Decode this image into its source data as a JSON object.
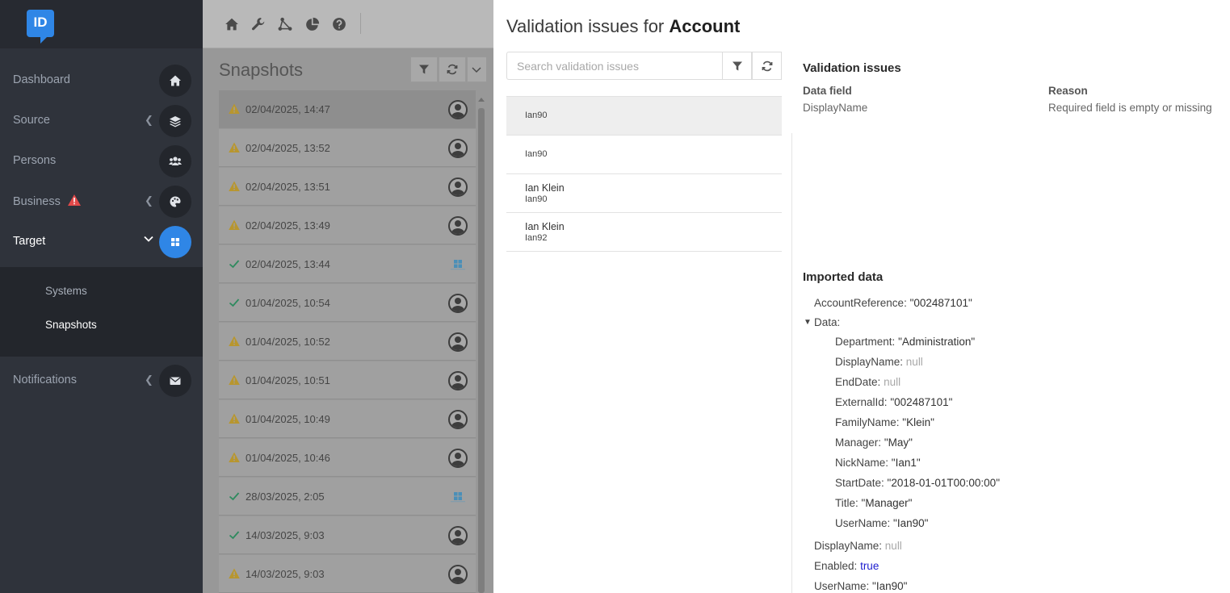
{
  "app": {
    "logo_text": "ID"
  },
  "sidebar": {
    "items": [
      {
        "label": "Dashboard",
        "icon": "home-icon"
      },
      {
        "label": "Source",
        "icon": "layers-icon"
      },
      {
        "label": "Persons",
        "icon": "users-icon"
      },
      {
        "label": "Business",
        "icon": "palette-icon",
        "warning": true
      },
      {
        "label": "Target",
        "icon": "grid-icon",
        "active": true
      },
      {
        "label": "Notifications",
        "icon": "envelope-icon"
      }
    ],
    "submenu": [
      {
        "label": "Systems"
      },
      {
        "label": "Snapshots",
        "active": true
      }
    ]
  },
  "toolbar": {
    "icons": [
      "home-icon",
      "wrench-icon",
      "flow-icon",
      "pie-chart-icon",
      "help-icon"
    ]
  },
  "snapshots": {
    "title": "Snapshots",
    "rows": [
      {
        "date": "02/04/2025, 14:47",
        "status": "warning",
        "source": "user",
        "selected": true
      },
      {
        "date": "02/04/2025, 13:52",
        "status": "warning",
        "source": "user"
      },
      {
        "date": "02/04/2025, 13:51",
        "status": "warning",
        "source": "user"
      },
      {
        "date": "02/04/2025, 13:49",
        "status": "warning",
        "source": "user"
      },
      {
        "date": "02/04/2025, 13:44",
        "status": "success",
        "source": "windows"
      },
      {
        "date": "01/04/2025, 10:54",
        "status": "success",
        "source": "user"
      },
      {
        "date": "01/04/2025, 10:52",
        "status": "warning",
        "source": "user"
      },
      {
        "date": "01/04/2025, 10:51",
        "status": "warning",
        "source": "user"
      },
      {
        "date": "01/04/2025, 10:49",
        "status": "warning",
        "source": "user"
      },
      {
        "date": "01/04/2025, 10:46",
        "status": "warning",
        "source": "user"
      },
      {
        "date": "28/03/2025, 2:05",
        "status": "success",
        "source": "windows"
      },
      {
        "date": "14/03/2025, 9:03",
        "status": "success",
        "source": "user"
      },
      {
        "date": "14/03/2025, 9:03",
        "status": "warning",
        "source": "user"
      }
    ]
  },
  "panel": {
    "title_prefix": "Validation issues for",
    "title_entity": "Account",
    "search_placeholder": "Search validation issues",
    "issues": [
      {
        "name": "",
        "sub": "Ian90",
        "selected": true
      },
      {
        "name": "",
        "sub": "Ian90"
      },
      {
        "name": "Ian Klein",
        "sub": "Ian90"
      },
      {
        "name": "Ian Klein",
        "sub": "Ian92"
      }
    ],
    "validation": {
      "heading": "Validation issues",
      "col_field": "Data field",
      "col_reason": "Reason",
      "field": "DisplayName",
      "reason": "Required field is empty or missing"
    },
    "imported": {
      "heading": "Imported data",
      "account_reference_key": "AccountReference",
      "account_reference_val": "\"002487101\"",
      "data_key": "Data",
      "data": [
        {
          "key": "Department",
          "val": "\"Administration\"",
          "type": "str"
        },
        {
          "key": "DisplayName",
          "val": "null",
          "type": "nul"
        },
        {
          "key": "EndDate",
          "val": "null",
          "type": "nul"
        },
        {
          "key": "ExternalId",
          "val": "\"002487101\"",
          "type": "str"
        },
        {
          "key": "FamilyName",
          "val": "\"Klein\"",
          "type": "str"
        },
        {
          "key": "Manager",
          "val": "\"May\"",
          "type": "str"
        },
        {
          "key": "NickName",
          "val": "\"Ian1\"",
          "type": "str"
        },
        {
          "key": "StartDate",
          "val": "\"2018-01-01T00:00:00\"",
          "type": "str"
        },
        {
          "key": "Title",
          "val": "\"Manager\"",
          "type": "str"
        },
        {
          "key": "UserName",
          "val": "\"Ian90\"",
          "type": "str"
        }
      ],
      "tail": [
        {
          "key": "DisplayName",
          "val": "null",
          "type": "nul"
        },
        {
          "key": "Enabled",
          "val": "true",
          "type": "boo"
        },
        {
          "key": "UserName",
          "val": "\"Ian90\"",
          "type": "str"
        }
      ]
    }
  }
}
